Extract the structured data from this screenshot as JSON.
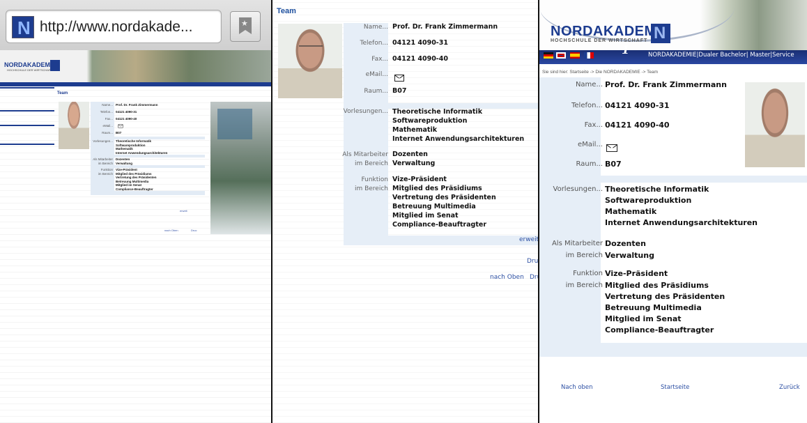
{
  "browser": {
    "url": "http://www.nordakade..."
  },
  "brand": {
    "name": "NORDAKADEMIE",
    "subtitle": "HOCHSCHULE DER WIRTSCHAFT"
  },
  "page": {
    "title": "Team",
    "breadcrumb": "Sie sind hier: Startseite -> Die NORDAKADEMIE -> Team",
    "nav_links": "NORDAKADEMIE|Dualer Bachelor| Master|Service"
  },
  "person": {
    "name_label": "Name...",
    "name": "Prof. Dr. Frank Zimmermann",
    "phone_label": "Telefon...",
    "phone": "04121 4090-31",
    "fax_label": "Fax...",
    "fax": "04121 4090-40",
    "email_label": "eMail...",
    "room_label": "Raum...",
    "room": "B07",
    "lectures_label": "Vorlesungen...",
    "lectures": [
      "Theoretische Informatik",
      "Softwareproduktion",
      "Mathematik",
      "Internet Anwendungsarchitekturen"
    ],
    "staff_label": "Als Mitarbeiter",
    "staff": "Dozenten",
    "area_label": "im Bereich",
    "area": "Verwaltung",
    "function_label": "Funktion",
    "function_area_label": "im Bereich",
    "functions": [
      "Vize-Präsident",
      "Mitglied des Präsidiums",
      "Vertretung des Präsidenten",
      "Betreuung Multimedia",
      "Mitglied im Senat",
      "Compliance-Beauftragter"
    ]
  },
  "links": {
    "erweitert": "erweit",
    "druck": "Druc",
    "druck_footer": "Dru",
    "nach_oben": "nach Oben",
    "mobile_nach_oben": "Nach oben",
    "mobile_startseite": "Startseite",
    "mobile_zurueck": "Zurück"
  }
}
